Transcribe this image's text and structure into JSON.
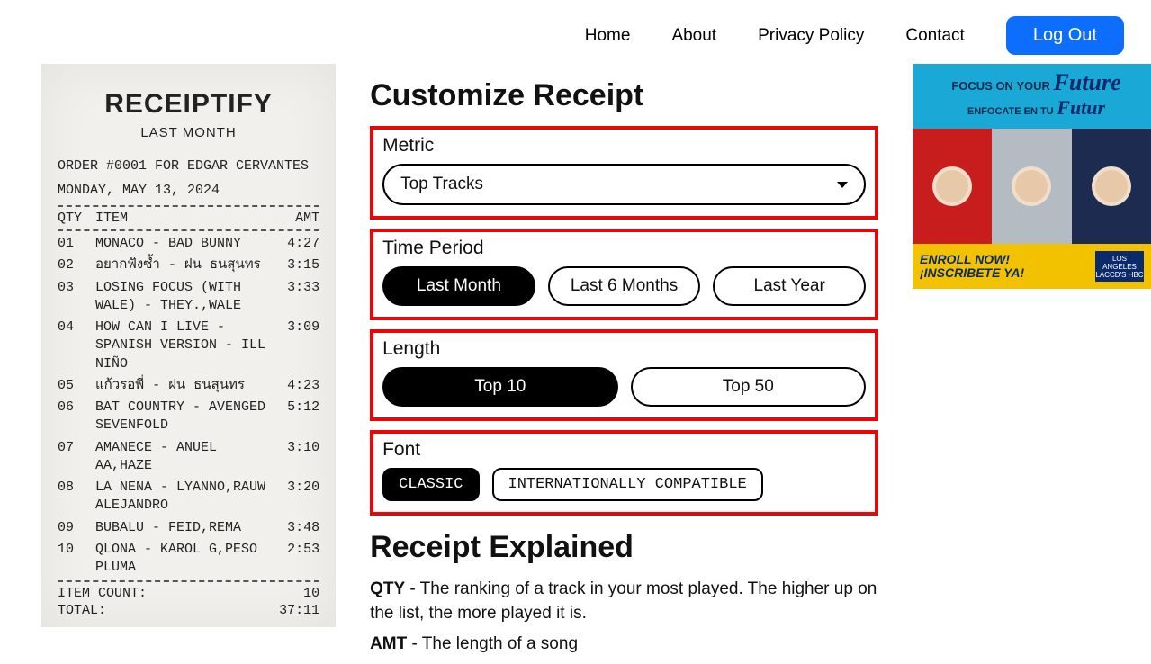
{
  "nav": {
    "home": "Home",
    "about": "About",
    "privacy": "Privacy Policy",
    "contact": "Contact",
    "logout": "Log Out"
  },
  "receipt": {
    "title": "RECEIPTIFY",
    "subtitle": "LAST MONTH",
    "order_line": "ORDER #0001 FOR EDGAR CERVANTES",
    "date_line": "MONDAY, MAY 13, 2024",
    "col_qty": "QTY",
    "col_item": "ITEM",
    "col_amt": "AMT",
    "rows": [
      {
        "qty": "01",
        "item": "MONACO - BAD BUNNY",
        "amt": "4:27"
      },
      {
        "qty": "02",
        "item": "อยากฟังซ้ำ - ฝน ธนสุนทร",
        "amt": "3:15"
      },
      {
        "qty": "03",
        "item": "LOSING FOCUS (WITH WALE) - THEY.,WALE",
        "amt": "3:33"
      },
      {
        "qty": "04",
        "item": "HOW CAN I LIVE - SPANISH VERSION - ILL NIÑO",
        "amt": "3:09"
      },
      {
        "qty": "05",
        "item": "แก้วรอพี่ - ฝน ธนสุนทร",
        "amt": "4:23"
      },
      {
        "qty": "06",
        "item": "BAT COUNTRY - AVENGED SEVENFOLD",
        "amt": "5:12"
      },
      {
        "qty": "07",
        "item": "AMANECE - ANUEL AA,HAZE",
        "amt": "3:10"
      },
      {
        "qty": "08",
        "item": "LA NENA - LYANNO,RAUW ALEJANDRO",
        "amt": "3:20"
      },
      {
        "qty": "09",
        "item": "BUBALU - FEID,REMA",
        "amt": "3:48"
      },
      {
        "qty": "10",
        "item": "QLONA - KAROL G,PESO PLUMA",
        "amt": "2:53"
      }
    ],
    "item_count_label": "ITEM COUNT:",
    "item_count": "10",
    "total_label": "TOTAL:",
    "total": "37:11"
  },
  "customize": {
    "heading": "Customize Receipt",
    "metric": {
      "label": "Metric",
      "selected": "Top Tracks"
    },
    "time": {
      "label": "Time Period",
      "options": [
        "Last Month",
        "Last 6 Months",
        "Last Year"
      ],
      "selected_index": 0
    },
    "length": {
      "label": "Length",
      "options": [
        "Top 10",
        "Top 50"
      ],
      "selected_index": 0
    },
    "font": {
      "label": "Font",
      "options": [
        "CLASSIC",
        "INTERNATIONALLY COMPATIBLE"
      ],
      "selected_index": 0
    }
  },
  "explain": {
    "heading": "Receipt Explained",
    "qty_b": "QTY",
    "qty_t": " - The ranking of a track in your most played. The higher up on the list, the more played it is.",
    "amt_b": "AMT",
    "amt_t": " - The length of a song"
  },
  "ad": {
    "line1": "FOCUS ON YOUR",
    "script1": "Future",
    "line2": "ENFOCATE EN TU",
    "script2": "Futur",
    "enroll1": "ENROLL NOW!",
    "enroll2": "¡INSCRIBETE YA!",
    "logo1": "LOS ANGELES",
    "logo2": "LACCD'S HBC"
  }
}
